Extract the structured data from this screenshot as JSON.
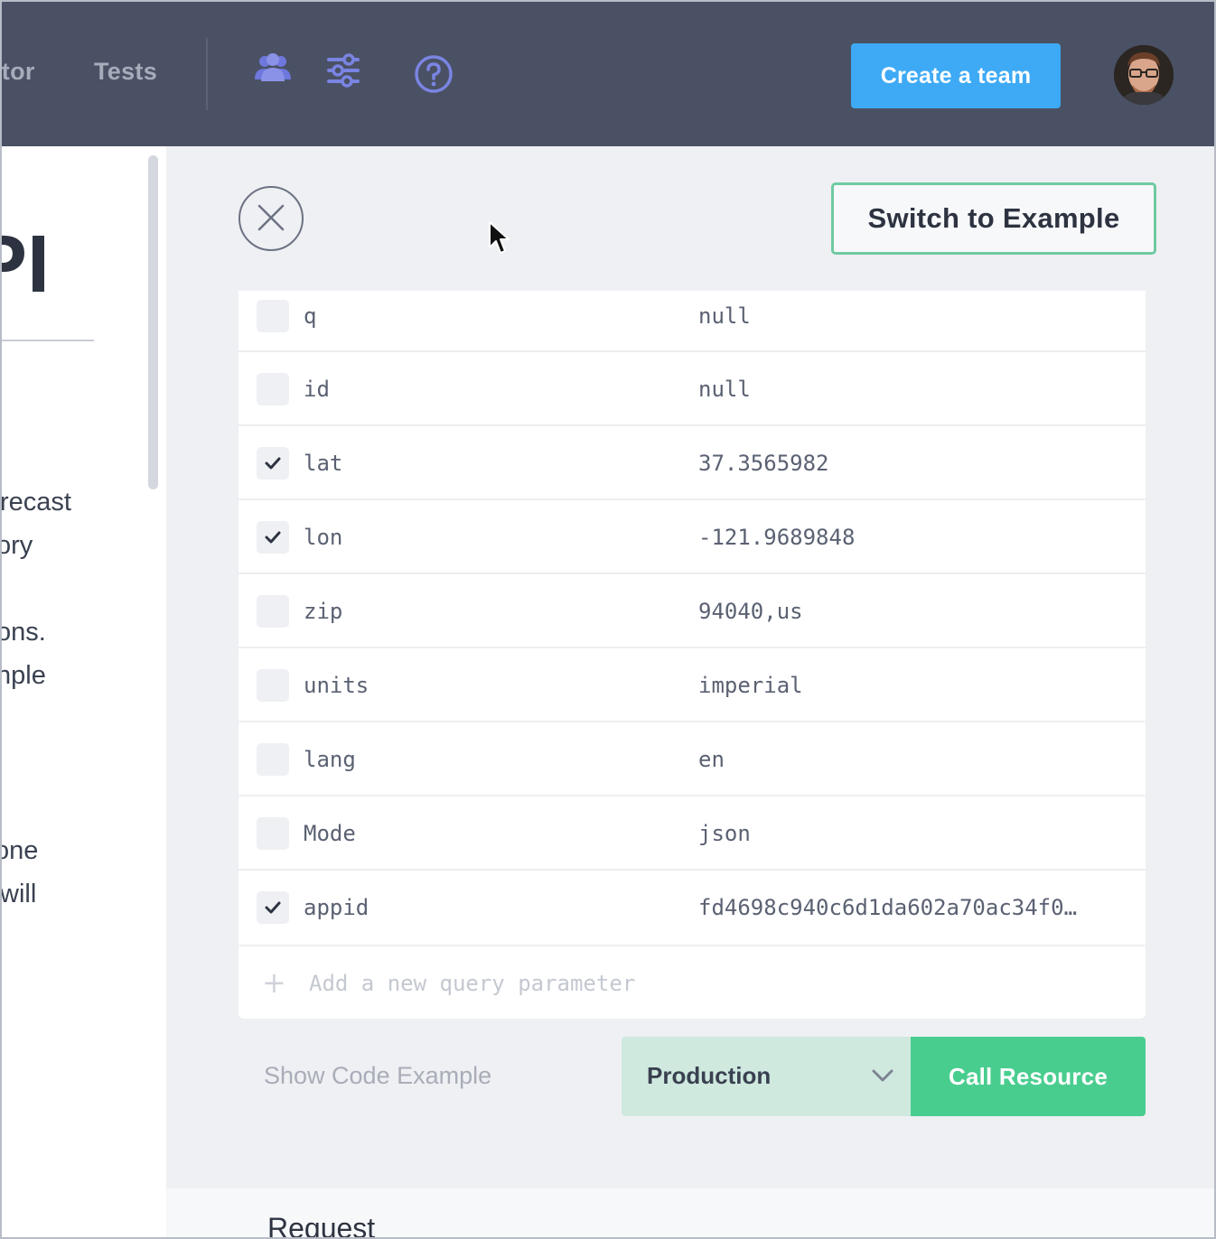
{
  "topbar": {
    "nav": [
      {
        "label": "Monitor",
        "visible_text": "itor"
      },
      {
        "label": "Tests"
      }
    ],
    "icons": [
      "team-icon",
      "sliders-icon",
      "help-icon"
    ],
    "create_team_label": "Create a team",
    "avatar": "user-avatar"
  },
  "left_panel": {
    "heading_fragment": "PI",
    "lines": [
      "recast",
      "ory",
      "ons.",
      "nple",
      "one",
      "will"
    ]
  },
  "main": {
    "close_icon": "close-icon",
    "switch_label": "Switch to Example",
    "params": [
      {
        "name": "q",
        "value": "null",
        "checked": false
      },
      {
        "name": "id",
        "value": "null",
        "checked": false
      },
      {
        "name": "lat",
        "value": "37.3565982",
        "checked": true
      },
      {
        "name": "lon",
        "value": "-121.9689848",
        "checked": true
      },
      {
        "name": "zip",
        "value": "94040,us",
        "checked": false
      },
      {
        "name": "units",
        "value": "imperial",
        "checked": false
      },
      {
        "name": "lang",
        "value": "en",
        "checked": false
      },
      {
        "name": "Mode",
        "value": "json",
        "checked": false
      },
      {
        "name": "appid",
        "value": "fd4698c940c6d1da602a70ac34f0…",
        "checked": true
      }
    ],
    "add_param_placeholder": "Add a new query parameter",
    "show_code_label": "Show Code Example",
    "environment": "Production",
    "call_label": "Call Resource",
    "request_title": "Request"
  },
  "colors": {
    "topbar_bg": "#4a5164",
    "primary_blue": "#3eaaf5",
    "success_green": "#49cd8f",
    "env_bg": "#cfe9df",
    "switch_border": "#6fcaa2"
  }
}
